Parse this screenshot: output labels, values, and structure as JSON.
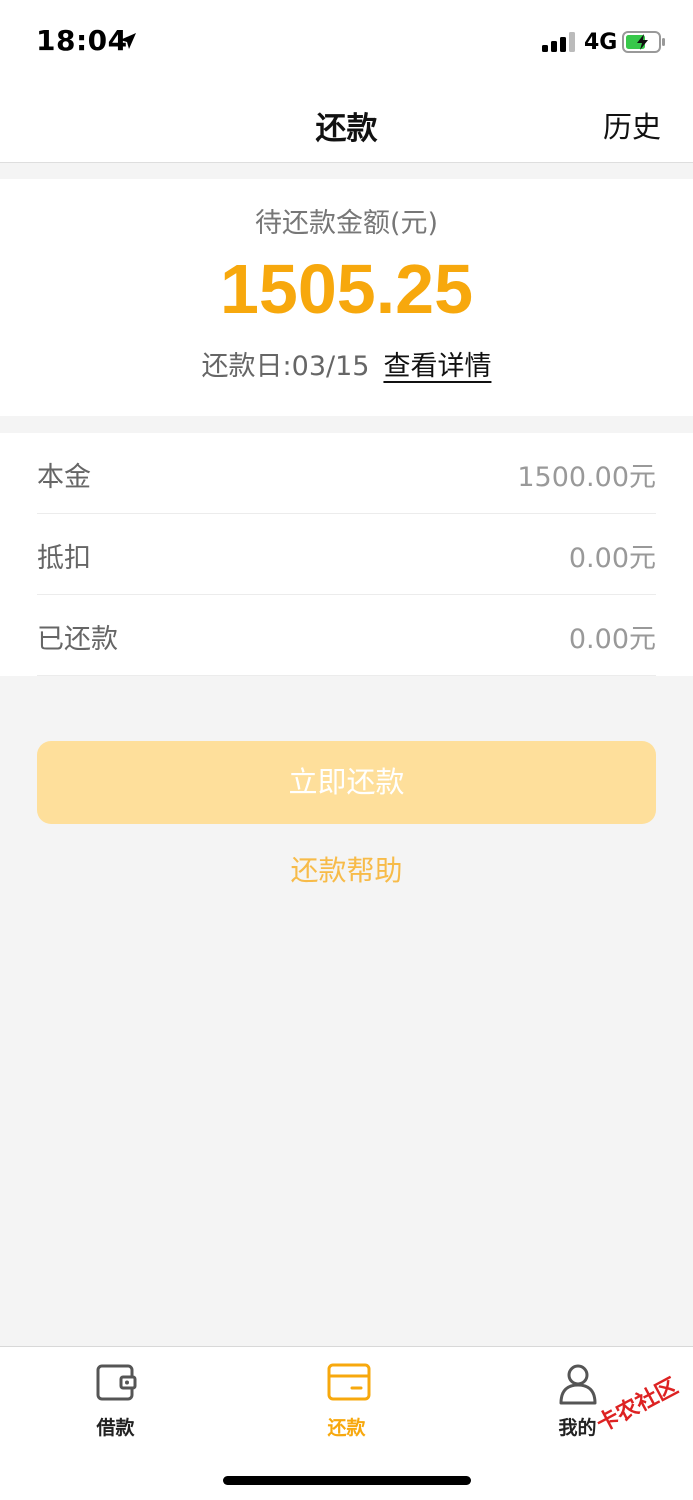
{
  "status_bar": {
    "time": "18:04",
    "network": "4G",
    "icons": [
      "location-arrow-icon",
      "signal-icon",
      "battery-charging-icon"
    ]
  },
  "nav": {
    "title": "还款",
    "history_label": "历史"
  },
  "amount": {
    "label": "待还款金额(元)",
    "value": "1505.25",
    "due_date": "还款日:03/15",
    "detail_link": "查看详情"
  },
  "breakdown": [
    {
      "label": "本金",
      "value": "1500.00元"
    },
    {
      "label": "抵扣",
      "value": "0.00元"
    },
    {
      "label": "已还款",
      "value": "0.00元"
    }
  ],
  "actions": {
    "repay_label": "立即还款",
    "help_label": "还款帮助"
  },
  "tabs": [
    {
      "label": "借款",
      "icon": "wallet-icon",
      "active": false
    },
    {
      "label": "还款",
      "icon": "card-icon",
      "active": true
    },
    {
      "label": "我的",
      "icon": "person-icon",
      "active": false
    }
  ],
  "watermark": "卡农社区",
  "colors": {
    "accent": "#f7a80d",
    "button_disabled": "#fedf9b",
    "help_link": "#f7bb49",
    "background": "#f4f4f4"
  }
}
